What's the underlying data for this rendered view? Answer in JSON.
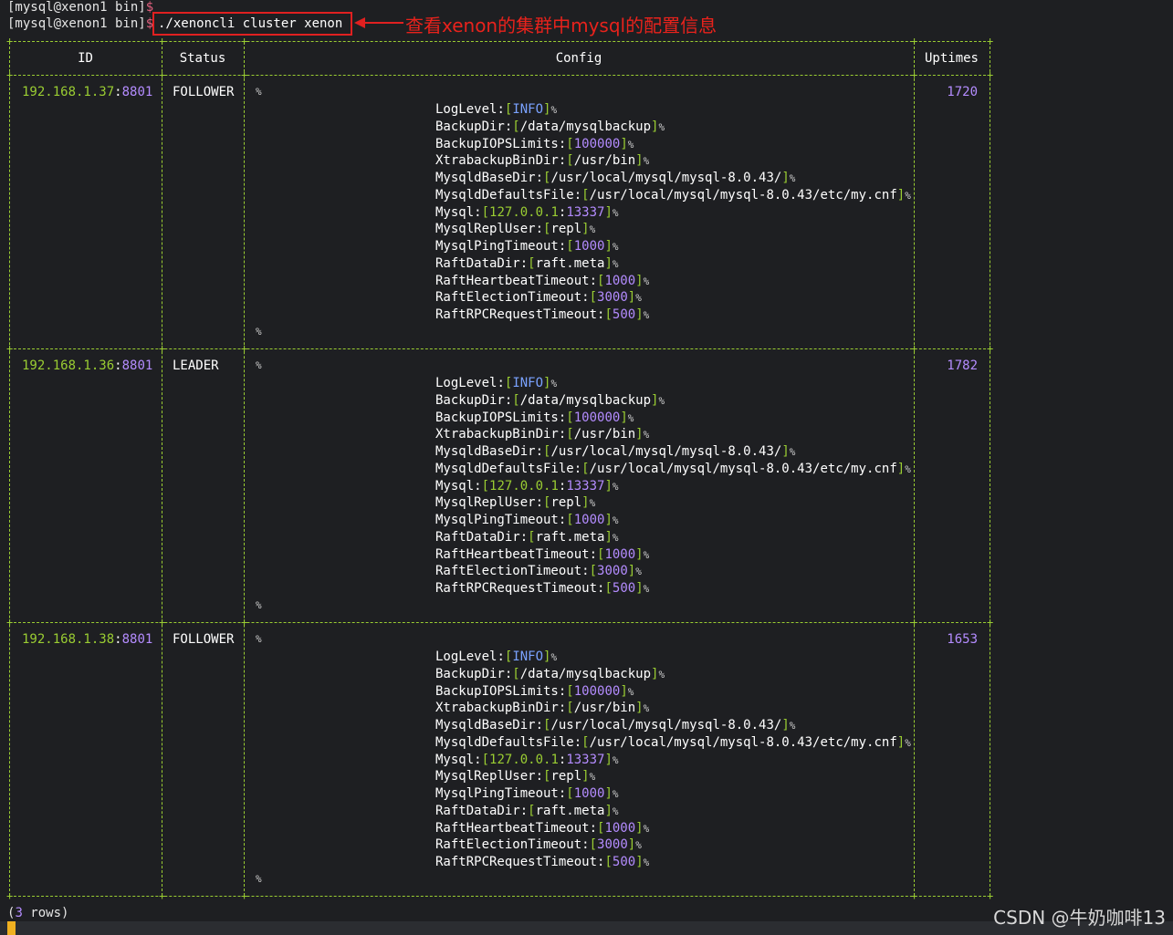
{
  "terminal": {
    "prompt1": "[mysql@xenon1 bin]",
    "prompt2": "[mysql@xenon1 bin]",
    "dollar": "$",
    "command": "./xenoncli cluster xenon",
    "annotation": "查看xenon的集群中mysql的配置信息",
    "annotation_color": "#e8221c"
  },
  "table": {
    "headers": [
      "ID",
      "Status",
      "Config",
      "Uptimes"
    ],
    "open_marker": "%",
    "close_marker": "%",
    "rows": [
      {
        "ip": "192.168.1.37",
        "port": "8801",
        "status": "FOLLOWER",
        "uptime": "1720"
      },
      {
        "ip": "192.168.1.36",
        "port": "8801",
        "status": "LEADER",
        "uptime": "1782"
      },
      {
        "ip": "192.168.1.38",
        "port": "8801",
        "status": "FOLLOWER",
        "uptime": "1653"
      }
    ],
    "config": [
      {
        "key": "LogLevel",
        "value": "INFO",
        "kind": "info"
      },
      {
        "key": "BackupDir",
        "value": "/data/mysqlbackup",
        "kind": "str"
      },
      {
        "key": "BackupIOPSLimits",
        "value": "100000",
        "kind": "num"
      },
      {
        "key": "XtrabackupBinDir",
        "value": "/usr/bin",
        "kind": "str"
      },
      {
        "key": "MysqldBaseDir",
        "value": "/usr/local/mysql/mysql-8.0.43/",
        "kind": "str"
      },
      {
        "key": "MysqldDefaultsFile",
        "value": "/usr/local/mysql/mysql-8.0.43/etc/my.cnf",
        "kind": "str"
      },
      {
        "key": "Mysql",
        "value_ip": "127.0.0.1",
        "value_port": "13337",
        "kind": "addr"
      },
      {
        "key": "MysqlReplUser",
        "value": "repl",
        "kind": "str"
      },
      {
        "key": "MysqlPingTimeout",
        "value": "1000",
        "kind": "num"
      },
      {
        "key": "RaftDataDir",
        "value": "raft.meta",
        "kind": "str"
      },
      {
        "key": "RaftHeartbeatTimeout",
        "value": "1000",
        "kind": "num"
      },
      {
        "key": "RaftElectionTimeout",
        "value": "3000",
        "kind": "num"
      },
      {
        "key": "RaftRPCRequestTimeout",
        "value": "500",
        "kind": "num"
      }
    ]
  },
  "footer": {
    "count": "3",
    "suffix": " rows)",
    "prefix": "("
  },
  "watermark": "CSDN @牛奶咖啡13"
}
